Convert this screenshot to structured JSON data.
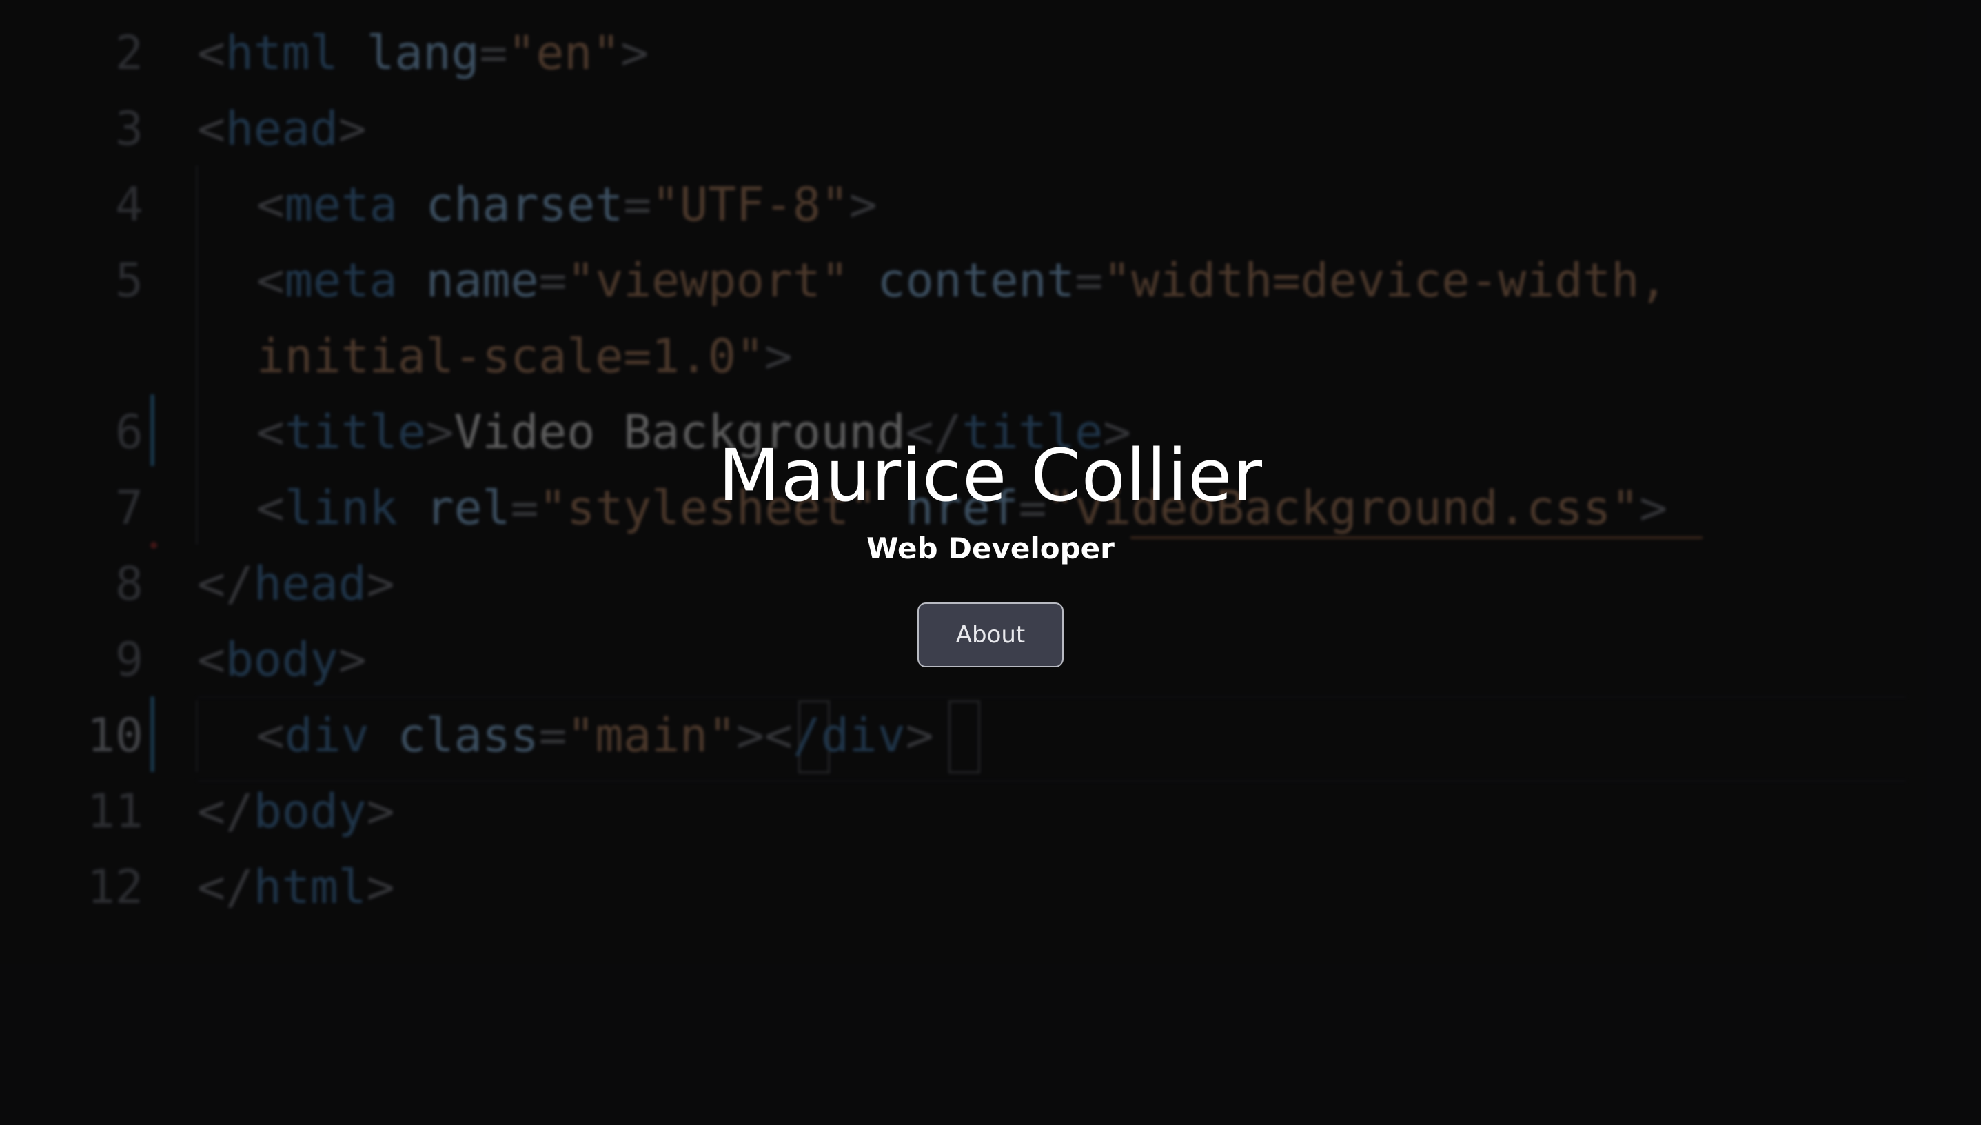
{
  "background_code": {
    "lines": [
      {
        "num": "2",
        "segments": [
          [
            "punc",
            "<"
          ],
          [
            "tag",
            "html"
          ],
          [
            "text",
            " "
          ],
          [
            "attr",
            "lang"
          ],
          [
            "punc",
            "="
          ],
          [
            "str",
            "\"en\""
          ],
          [
            "punc",
            ">"
          ]
        ]
      },
      {
        "num": "3",
        "segments": [
          [
            "punc",
            "<"
          ],
          [
            "tag",
            "head"
          ],
          [
            "punc",
            ">"
          ]
        ]
      },
      {
        "num": "4",
        "segments": [
          [
            "punc",
            "<"
          ],
          [
            "tag",
            "meta"
          ],
          [
            "text",
            " "
          ],
          [
            "attr",
            "charset"
          ],
          [
            "punc",
            "="
          ],
          [
            "str",
            "\"UTF-8\""
          ],
          [
            "punc",
            ">"
          ]
        ]
      },
      {
        "num": "5",
        "segments": [
          [
            "punc",
            "<"
          ],
          [
            "tag",
            "meta"
          ],
          [
            "text",
            " "
          ],
          [
            "attr",
            "name"
          ],
          [
            "punc",
            "="
          ],
          [
            "str",
            "\"viewport\""
          ],
          [
            "text",
            " "
          ],
          [
            "attr",
            "content"
          ],
          [
            "punc",
            "="
          ],
          [
            "str",
            "\"width=device-width,"
          ]
        ]
      },
      {
        "num": "",
        "segments": [
          [
            "str",
            "initial-scale=1.0\""
          ],
          [
            "punc",
            ">"
          ]
        ]
      },
      {
        "num": "6",
        "segments": [
          [
            "punc",
            "<"
          ],
          [
            "tag",
            "title"
          ],
          [
            "punc",
            ">"
          ],
          [
            "text",
            "Video Background"
          ],
          [
            "punc",
            "</"
          ],
          [
            "tag",
            "title"
          ],
          [
            "punc",
            ">"
          ]
        ]
      },
      {
        "num": "7",
        "segments": [
          [
            "punc",
            "<"
          ],
          [
            "tag",
            "link"
          ],
          [
            "text",
            " "
          ],
          [
            "attr",
            "rel"
          ],
          [
            "punc",
            "="
          ],
          [
            "str",
            "\"stylesheet\""
          ],
          [
            "text",
            " "
          ],
          [
            "attr",
            "href"
          ],
          [
            "punc",
            "="
          ],
          [
            "str",
            "\"videoBackground.css\""
          ],
          [
            "punc",
            ">"
          ]
        ]
      },
      {
        "num": "8",
        "segments": [
          [
            "punc",
            "</"
          ],
          [
            "tag",
            "head"
          ],
          [
            "punc",
            ">"
          ]
        ]
      },
      {
        "num": "9",
        "segments": [
          [
            "punc",
            "<"
          ],
          [
            "tag",
            "body"
          ],
          [
            "punc",
            ">"
          ]
        ]
      },
      {
        "num": "10",
        "segments": [
          [
            "punc",
            "<"
          ],
          [
            "tag",
            "div"
          ],
          [
            "text",
            " "
          ],
          [
            "attr",
            "class"
          ],
          [
            "punc",
            "="
          ],
          [
            "str",
            "\"main\""
          ],
          [
            "punc",
            "><"
          ],
          [
            "tag",
            "/div"
          ],
          [
            "punc",
            ">"
          ]
        ]
      },
      {
        "num": "11",
        "segments": [
          [
            "punc",
            "</"
          ],
          [
            "tag",
            "body"
          ],
          [
            "punc",
            ">"
          ]
        ]
      },
      {
        "num": "12",
        "segments": [
          [
            "punc",
            "</"
          ],
          [
            "tag",
            "html"
          ],
          [
            "punc",
            ">"
          ]
        ]
      }
    ],
    "colors": {
      "punc": "#6d6f76",
      "tag": "#3f6f9c",
      "attr": "#7fa9cf",
      "str": "#a17658",
      "text": "#c9c9c9"
    }
  },
  "hero": {
    "name": "Maurice Collier",
    "title": "Web Developer",
    "about_label": "About"
  },
  "colors": {
    "background": "#0e0e0f",
    "button_bg": "#3d3f4c",
    "button_border": "#b8bac2",
    "text": "#ffffff"
  }
}
